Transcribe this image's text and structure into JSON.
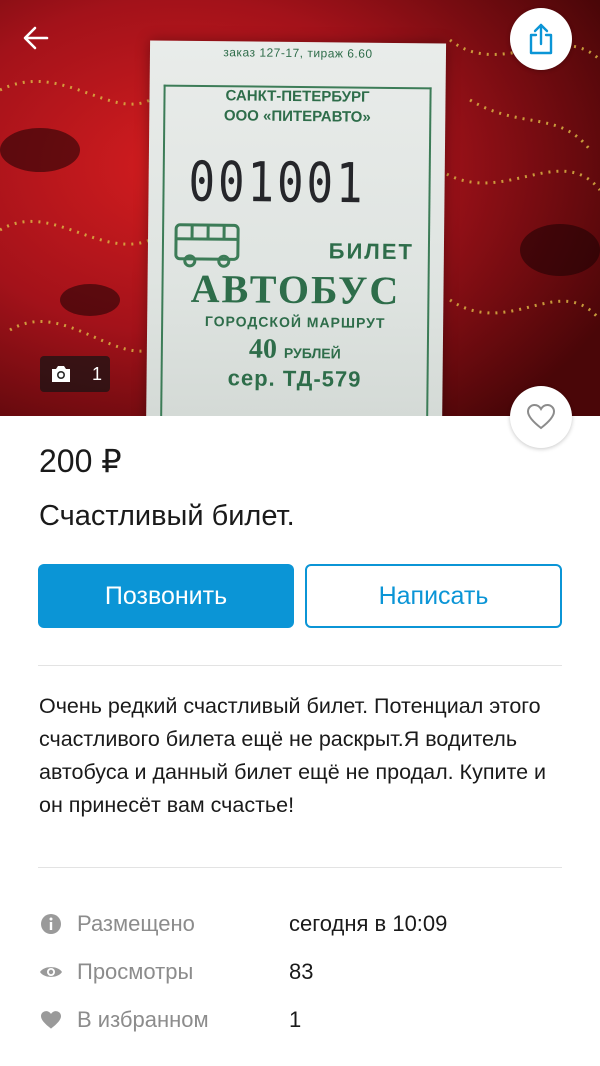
{
  "photo": {
    "count": "1",
    "ticket": {
      "order_line": "заказ 127-17, тираж 6.60",
      "city": "САНКТ-ПЕТЕРБУРГ",
      "company": "ООО «ПИТЕРАВТО»",
      "number": "001001",
      "label": "БИЛЕТ",
      "kind": "АВТОБУС",
      "route": "ГОРОДСКОЙ МАРШРУТ",
      "price_value": "40",
      "price_unit": "РУБЛЕЙ",
      "series": "сер. ТД-579"
    }
  },
  "listing": {
    "price": "200 ₽",
    "title": "Счастливый билет.",
    "call_label": "Позвонить",
    "write_label": "Написать",
    "description": "Очень редкий счастливый билет. Потенциал этого счастливого билета ещё не раскрыт.Я водитель автобуса и данный билет ещё не продал. Купите и он принесёт вам счастье!"
  },
  "stats": [
    {
      "icon": "info-icon",
      "label": "Размещено",
      "value": "сегодня в 10:09"
    },
    {
      "icon": "eye-icon",
      "label": "Просмотры",
      "value": "83"
    },
    {
      "icon": "heart-icon",
      "label": "В избранном",
      "value": "1"
    }
  ],
  "colors": {
    "accent": "#0b95d6",
    "muted_text": "#8c8c8c",
    "icon_gray": "#9a9a9a"
  }
}
